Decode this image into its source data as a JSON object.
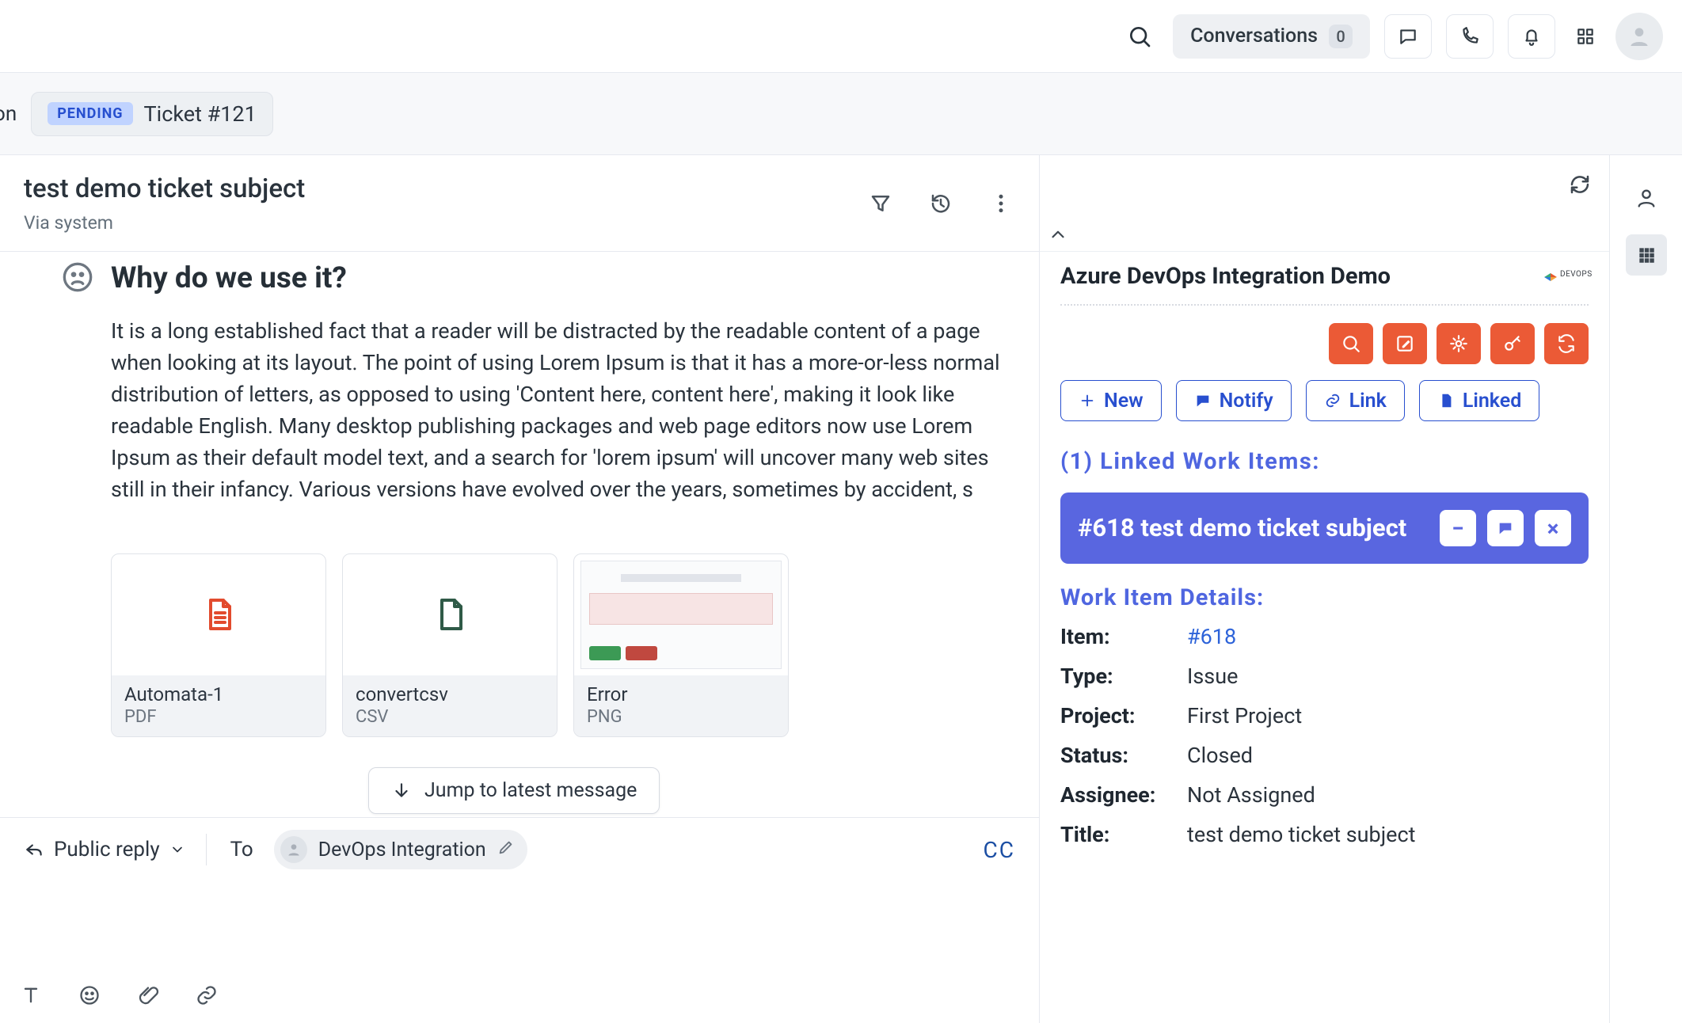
{
  "topbar": {
    "conversations_label": "Conversations",
    "conversations_count": "0"
  },
  "breadcrumb": {
    "leading_fragment": "on",
    "status": "PENDING",
    "ticket_label": "Ticket #121"
  },
  "ticket": {
    "subject": "test demo ticket subject",
    "via": "Via system"
  },
  "message": {
    "heading": "Why do we use it?",
    "body": "It is a long established fact that a reader will be distracted by the readable content of a page when looking at its layout. The point of using Lorem Ipsum is that it has a more-or-less normal distribution of letters, as opposed to using 'Content here, content here', making it look like readable English. Many desktop publishing packages and web page editors now use Lorem Ipsum as their default model text, and a search for 'lorem ipsum' will uncover many web sites still in their infancy. Various versions have evolved over the years, sometimes by accident, s"
  },
  "attachments": [
    {
      "name": "Automata-1",
      "type": "PDF",
      "icon": "pdf"
    },
    {
      "name": "convertcsv",
      "type": "CSV",
      "icon": "file"
    },
    {
      "name": "Error",
      "type": "PNG",
      "icon": "image"
    }
  ],
  "jump_label": "Jump to latest message",
  "reply": {
    "mode": "Public reply",
    "to_label": "To",
    "recipient": "DevOps Integration",
    "cc_label": "CC"
  },
  "panel": {
    "title": "Azure DevOps Integration Demo",
    "actions": {
      "new": "New",
      "notify": "Notify",
      "link": "Link",
      "linked": "Linked"
    },
    "linked_section_title": "(1) Linked Work Items:",
    "linked_item_title": "#618 test demo ticket subject",
    "details_title": "Work Item Details:",
    "details": {
      "item_label": "Item:",
      "item_value": "#618",
      "type_label": "Type:",
      "type_value": "Issue",
      "project_label": "Project:",
      "project_value": "First Project",
      "status_label": "Status:",
      "status_value": "Closed",
      "assignee_label": "Assignee:",
      "assignee_value": "Not Assigned",
      "title_label": "Title:",
      "title_value": "test demo ticket subject"
    }
  }
}
